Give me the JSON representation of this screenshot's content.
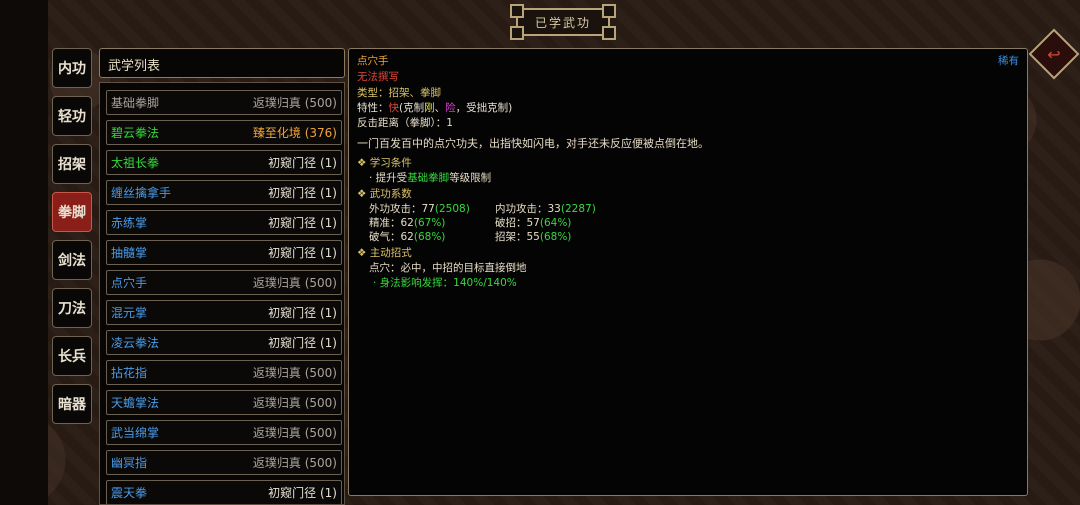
{
  "title": "已学武功",
  "colors": {
    "blue": "#4a9be8",
    "green": "#36d83e",
    "gold": "#f0a43a",
    "gray": "#a9a39b",
    "white": "#e6e0d2",
    "red": "#e0453a",
    "yellow": "#d9c268"
  },
  "tabs": [
    {
      "label": "内功",
      "active": false
    },
    {
      "label": "轻功",
      "active": false
    },
    {
      "label": "招架",
      "active": false
    },
    {
      "label": "拳脚",
      "active": true
    },
    {
      "label": "剑法",
      "active": false
    },
    {
      "label": "刀法",
      "active": false
    },
    {
      "label": "长兵",
      "active": false
    },
    {
      "label": "暗器",
      "active": false
    }
  ],
  "list": {
    "header": "武学列表",
    "items": [
      {
        "name": "基础拳脚",
        "rank": "返璞归真 (500)",
        "name_color": "gray",
        "rank_color": "gray"
      },
      {
        "name": "碧云拳法",
        "rank": "臻至化境 (376)",
        "name_color": "green",
        "rank_color": "gold"
      },
      {
        "name": "太祖长拳",
        "rank": "初窥门径 (1)",
        "name_color": "green",
        "rank_color": "white"
      },
      {
        "name": "缠丝擒拿手",
        "rank": "初窥门径 (1)",
        "name_color": "blue",
        "rank_color": "white"
      },
      {
        "name": "赤练掌",
        "rank": "初窥门径 (1)",
        "name_color": "blue",
        "rank_color": "white"
      },
      {
        "name": "抽髓掌",
        "rank": "初窥门径 (1)",
        "name_color": "blue",
        "rank_color": "white"
      },
      {
        "name": "点穴手",
        "rank": "返璞归真 (500)",
        "name_color": "blue",
        "rank_color": "gray"
      },
      {
        "name": "混元掌",
        "rank": "初窥门径 (1)",
        "name_color": "blue",
        "rank_color": "white"
      },
      {
        "name": "凌云拳法",
        "rank": "初窥门径 (1)",
        "name_color": "blue",
        "rank_color": "white"
      },
      {
        "name": "拈花指",
        "rank": "返璞归真 (500)",
        "name_color": "blue",
        "rank_color": "gray"
      },
      {
        "name": "天蟾掌法",
        "rank": "返璞归真 (500)",
        "name_color": "blue",
        "rank_color": "gray"
      },
      {
        "name": "武当绵掌",
        "rank": "返璞归真 (500)",
        "name_color": "blue",
        "rank_color": "gray"
      },
      {
        "name": "幽冥指",
        "rank": "返璞归真 (500)",
        "name_color": "blue",
        "rank_color": "gray"
      },
      {
        "name": "震天拳",
        "rank": "初窥门径 (1)",
        "name_color": "blue",
        "rank_color": "white"
      }
    ]
  },
  "detail": {
    "name": "点穴手",
    "rarity": "稀有",
    "unequip": "无法撰写",
    "type_label": "类型：",
    "type_value": "招架、拳脚",
    "trait_label": "特性：",
    "trait_fast": "快",
    "trait_p1": "(克制",
    "trait_hard": "刚",
    "trait_sep": "、",
    "trait_dan": "险",
    "trait_p2": "，受拙克制)",
    "counter": "反击距离（拳脚）：1",
    "description": "一门百发百中的点穴功夫，出指快如闪电，对手还未反应便被点倒在地。",
    "req_header": "❖ 学习条件",
    "req_prefix": "· 提升受",
    "req_link": "基础拳脚",
    "req_suffix": "等级限制",
    "coef_header": "❖ 武功系数",
    "ext_label": "外功攻击：77",
    "ext_bonus": "(2508)",
    "int_label": "内功攻击：33",
    "int_bonus": "(2287)",
    "acc_label": "精准：62",
    "acc_bonus": "(67%)",
    "break_label": "破招：57",
    "break_bonus": "(64%)",
    "qi_label": "破气：62",
    "qi_bonus": "(68%)",
    "parry_label": "招架：55",
    "parry_bonus": "(68%)",
    "active_header": "❖ 主动招式",
    "active_move": "点穴：必中，中招的目标直接倒地",
    "active_sub": "· 身法影响发挥：140%/140%"
  }
}
